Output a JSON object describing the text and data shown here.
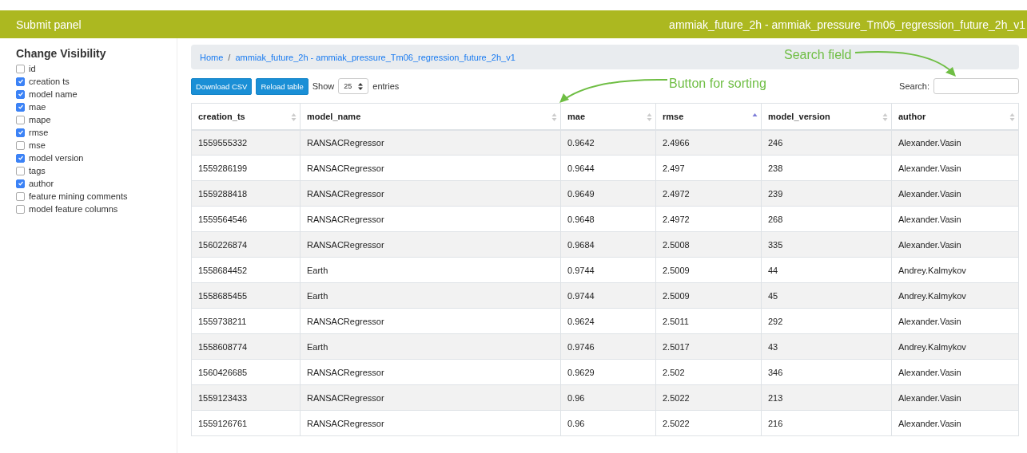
{
  "header": {
    "title": "Submit panel",
    "project": "ammiak_future_2h - ammiak_pressure_Tm06_regression_future_2h_v1"
  },
  "sidebar": {
    "title": "Change Visibility",
    "items": [
      {
        "label": "id",
        "checked": false
      },
      {
        "label": "creation ts",
        "checked": true
      },
      {
        "label": "model name",
        "checked": true
      },
      {
        "label": "mae",
        "checked": true
      },
      {
        "label": "mape",
        "checked": false
      },
      {
        "label": "rmse",
        "checked": true
      },
      {
        "label": "mse",
        "checked": false
      },
      {
        "label": "model version",
        "checked": true
      },
      {
        "label": "tags",
        "checked": false
      },
      {
        "label": "author",
        "checked": true
      },
      {
        "label": "feature mining comments",
        "checked": false
      },
      {
        "label": "model feature columns",
        "checked": false
      }
    ]
  },
  "breadcrumb": {
    "separator": "/",
    "items": [
      {
        "label": "Home"
      },
      {
        "label": "ammiak_future_2h - ammiak_pressure_Tm06_regression_future_2h_v1"
      }
    ]
  },
  "toolbar": {
    "buttons": [
      "Download CSV",
      "Reload table"
    ],
    "show_label": "Show",
    "page_size": "25",
    "entries_label": "entries",
    "search_label": "Search:"
  },
  "annotations": [
    {
      "kind": "search",
      "text": "Search field"
    },
    {
      "kind": "sort",
      "text": "Button for sorting"
    }
  ],
  "table": {
    "columns": [
      {
        "label": "creation_ts",
        "sorted": false
      },
      {
        "label": "model_name",
        "sorted": false
      },
      {
        "label": "mae",
        "sorted": false
      },
      {
        "label": "rmse",
        "sorted": true
      },
      {
        "label": "model_version",
        "sorted": false
      },
      {
        "label": "author",
        "sorted": false
      }
    ],
    "rows": [
      [
        "1559555332",
        "RANSACRegressor",
        "0.9642",
        "2.4966",
        "246",
        "Alexander.Vasin"
      ],
      [
        "1559286199",
        "RANSACRegressor",
        "0.9644",
        "2.497",
        "238",
        "Alexander.Vasin"
      ],
      [
        "1559288418",
        "RANSACRegressor",
        "0.9649",
        "2.4972",
        "239",
        "Alexander.Vasin"
      ],
      [
        "1559564546",
        "RANSACRegressor",
        "0.9648",
        "2.4972",
        "268",
        "Alexander.Vasin"
      ],
      [
        "1560226874",
        "RANSACRegressor",
        "0.9684",
        "2.5008",
        "335",
        "Alexander.Vasin"
      ],
      [
        "1558684452",
        "Earth",
        "0.9744",
        "2.5009",
        "44",
        "Andrey.Kalmykov"
      ],
      [
        "1558685455",
        "Earth",
        "0.9744",
        "2.5009",
        "45",
        "Andrey.Kalmykov"
      ],
      [
        "1559738211",
        "RANSACRegressor",
        "0.9624",
        "2.5011",
        "292",
        "Alexander.Vasin"
      ],
      [
        "1558608774",
        "Earth",
        "0.9746",
        "2.5017",
        "43",
        "Andrey.Kalmykov"
      ],
      [
        "1560426685",
        "RANSACRegressor",
        "0.9629",
        "2.502",
        "346",
        "Alexander.Vasin"
      ],
      [
        "1559123433",
        "RANSACRegressor",
        "0.96",
        "2.5022",
        "213",
        "Alexander.Vasin"
      ],
      [
        "1559126761",
        "RANSACRegressor",
        "0.96",
        "2.5022",
        "216",
        "Alexander.Vasin"
      ]
    ]
  }
}
